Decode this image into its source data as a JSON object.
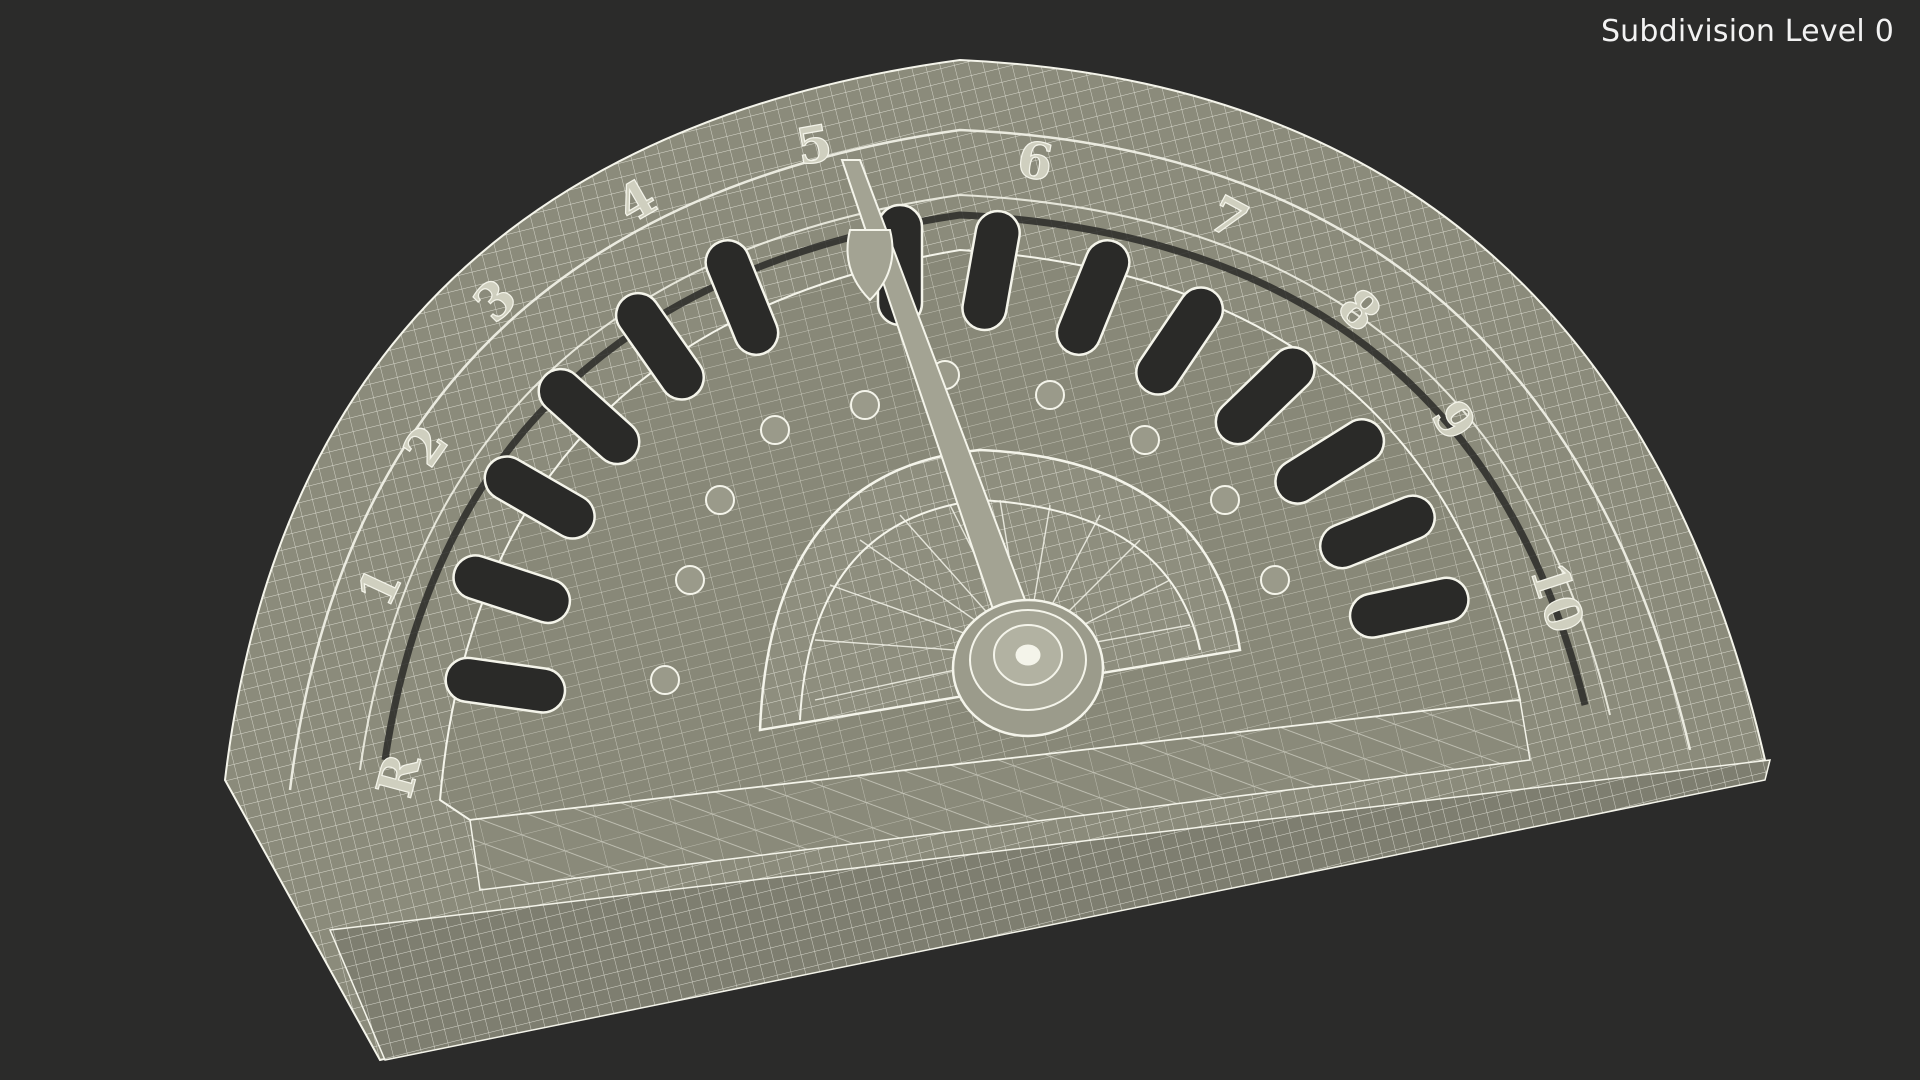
{
  "viewport": {
    "label": "Subdivision Level 0",
    "background_color": "#2b2b2a"
  },
  "model": {
    "description_icon": "wireframe-thermostat-dial-icon",
    "mesh_fill_color": "#8b8b7b",
    "wire_color": "#f4f4ea",
    "window_color": "#2a2a28",
    "dial_labels": [
      "R",
      "1",
      "2",
      "3",
      "4",
      "5",
      "6",
      "7",
      "8",
      "9",
      "10"
    ]
  }
}
